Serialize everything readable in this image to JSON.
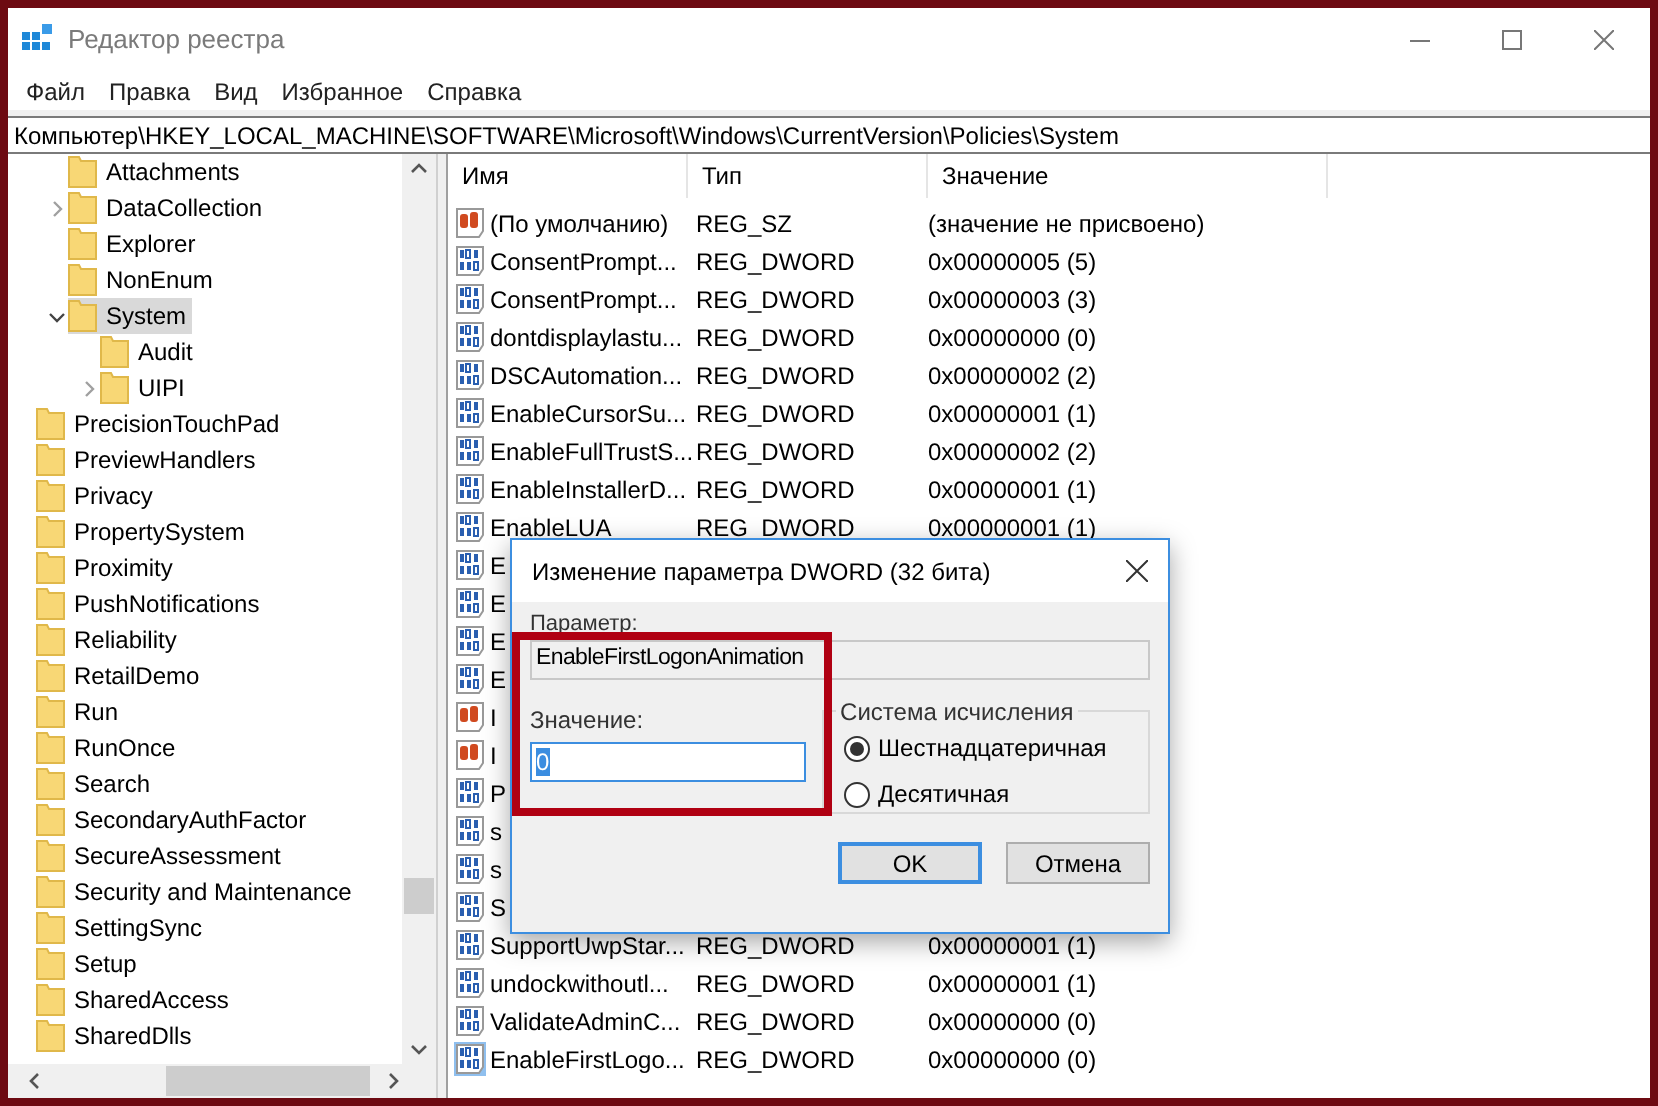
{
  "window": {
    "title": "Редактор реестра"
  },
  "menu": [
    "Файл",
    "Правка",
    "Вид",
    "Избранное",
    "Справка"
  ],
  "address": "Компьютер\\HKEY_LOCAL_MACHINE\\SOFTWARE\\Microsoft\\Windows\\CurrentVersion\\Policies\\System",
  "tree": {
    "policies_children": [
      {
        "label": "Attachments",
        "selected": false
      },
      {
        "label": "DataCollection",
        "expanded": false,
        "selected": false
      },
      {
        "label": "Explorer",
        "selected": false
      },
      {
        "label": "NonEnum",
        "selected": false
      },
      {
        "label": "System",
        "expanded": true,
        "selected": true,
        "children": [
          {
            "label": "Audit",
            "selected": false
          },
          {
            "label": "UIPI",
            "expanded": false,
            "selected": false
          }
        ]
      }
    ],
    "items": [
      {
        "label": "PrecisionTouchPad",
        "selected": false
      },
      {
        "label": "PreviewHandlers",
        "selected": false
      },
      {
        "label": "Privacy",
        "selected": false
      },
      {
        "label": "PropertySystem",
        "selected": false
      },
      {
        "label": "Proximity",
        "selected": false
      },
      {
        "label": "PushNotifications",
        "selected": false
      },
      {
        "label": "Reliability",
        "selected": false
      },
      {
        "label": "RetailDemo",
        "selected": false
      },
      {
        "label": "Run",
        "selected": false
      },
      {
        "label": "RunOnce",
        "selected": false
      },
      {
        "label": "Search",
        "selected": false
      },
      {
        "label": "SecondaryAuthFactor",
        "selected": false
      },
      {
        "label": "SecureAssessment",
        "selected": false
      },
      {
        "label": "Security and Maintenance",
        "selected": false
      },
      {
        "label": "SettingSync",
        "selected": false
      },
      {
        "label": "Setup",
        "selected": false
      },
      {
        "label": "SharedAccess",
        "selected": false
      },
      {
        "label": "SharedDlls",
        "selected": false
      }
    ]
  },
  "table": {
    "columns": [
      "Имя",
      "Тип",
      "Значение"
    ],
    "rows": [
      {
        "kind": "string",
        "name": "(По умолчанию)",
        "type": "REG_SZ",
        "value": "(значение не присвоено)",
        "selected": false
      },
      {
        "kind": "dword",
        "name": "ConsentPrompt...",
        "type": "REG_DWORD",
        "value": "0x00000005 (5)",
        "selected": false
      },
      {
        "kind": "dword",
        "name": "ConsentPrompt...",
        "type": "REG_DWORD",
        "value": "0x00000003 (3)",
        "selected": false
      },
      {
        "kind": "dword",
        "name": "dontdisplaylastu...",
        "type": "REG_DWORD",
        "value": "0x00000000 (0)",
        "selected": false
      },
      {
        "kind": "dword",
        "name": "DSCAutomation...",
        "type": "REG_DWORD",
        "value": "0x00000002 (2)",
        "selected": false
      },
      {
        "kind": "dword",
        "name": "EnableCursorSu...",
        "type": "REG_DWORD",
        "value": "0x00000001 (1)",
        "selected": false
      },
      {
        "kind": "dword",
        "name": "EnableFullTrustS...",
        "type": "REG_DWORD",
        "value": "0x00000002 (2)",
        "selected": false
      },
      {
        "kind": "dword",
        "name": "EnableInstallerD...",
        "type": "REG_DWORD",
        "value": "0x00000001 (1)",
        "selected": false
      },
      {
        "kind": "dword",
        "name": "EnableLUA",
        "type": "REG_DWORD",
        "value": "0x00000001 (1)",
        "selected": false
      },
      {
        "kind": "dword",
        "name": "E",
        "selected": false
      },
      {
        "kind": "dword",
        "name": "E",
        "selected": false
      },
      {
        "kind": "dword",
        "name": "E",
        "selected": false
      },
      {
        "kind": "dword",
        "name": "E",
        "selected": false
      },
      {
        "kind": "string",
        "name": "I",
        "selected": false
      },
      {
        "kind": "string",
        "name": "I",
        "selected": false
      },
      {
        "kind": "dword",
        "name": "P",
        "selected": false
      },
      {
        "kind": "dword",
        "name": "s",
        "selected": false
      },
      {
        "kind": "dword",
        "name": "s",
        "selected": false
      },
      {
        "kind": "dword",
        "name": "S",
        "selected": false
      },
      {
        "kind": "dword",
        "name": "SupportUwpStar...",
        "type": "REG_DWORD",
        "value": "0x00000001 (1)",
        "selected": false
      },
      {
        "kind": "dword",
        "name": "undockwithoutl...",
        "type": "REG_DWORD",
        "value": "0x00000001 (1)",
        "selected": false
      },
      {
        "kind": "dword",
        "name": "ValidateAdminC...",
        "type": "REG_DWORD",
        "value": "0x00000000 (0)",
        "selected": false
      },
      {
        "kind": "dword",
        "name": "EnableFirstLogo...",
        "type": "REG_DWORD",
        "value": "0x00000000 (0)",
        "selected": true
      }
    ]
  },
  "dialog": {
    "title": "Изменение параметра DWORD (32 бита)",
    "parameter_label": "Параметр:",
    "parameter_value": "EnableFirstLogonAnimation",
    "value_label": "Значение:",
    "value": "0",
    "value_text_selected": true,
    "base_group": {
      "title": "Система исчисления",
      "options": [
        {
          "label": "Шестнадцатеричная",
          "selected": true
        },
        {
          "label": "Десятичная",
          "selected": false
        }
      ]
    },
    "buttons": [
      {
        "label": "OK",
        "default": true
      },
      {
        "label": "Отмена",
        "default": false
      }
    ]
  }
}
